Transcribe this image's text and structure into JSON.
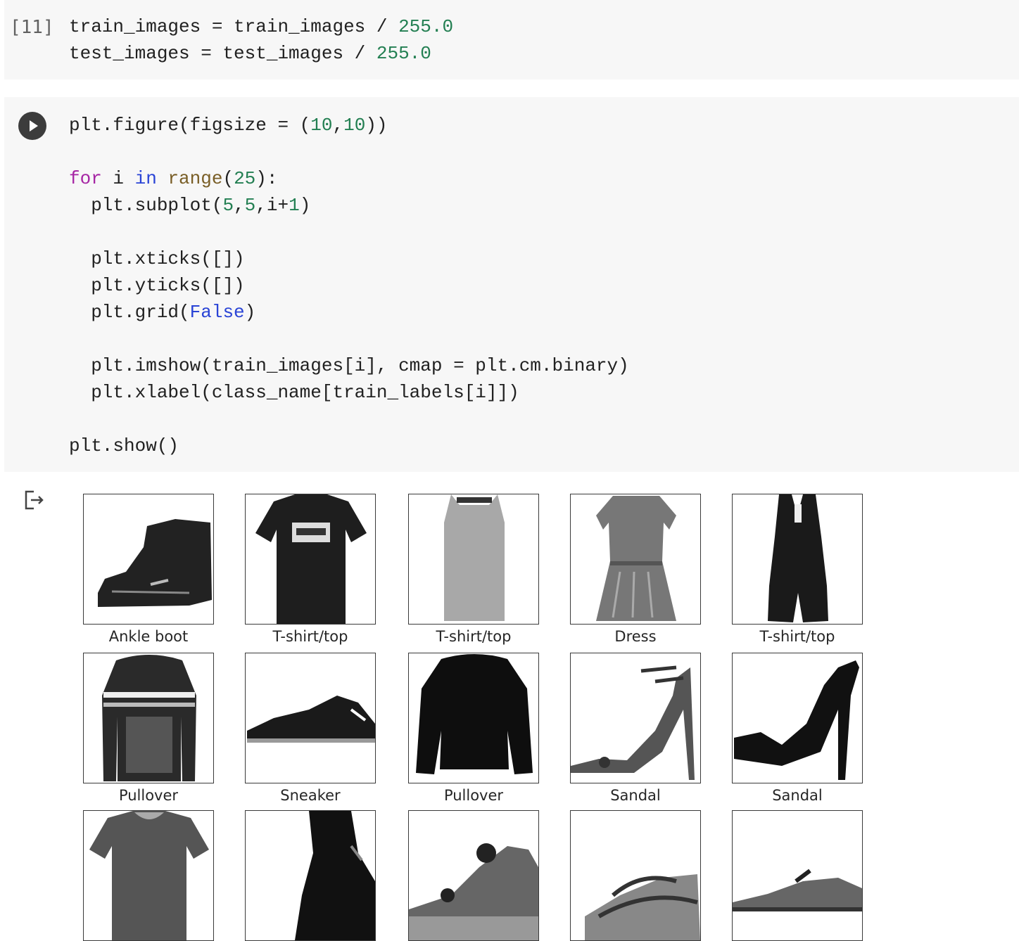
{
  "cell1": {
    "exec_count": "[11]",
    "lines": [
      [
        {
          "t": "train_images = train_images / ",
          "c": ""
        },
        {
          "t": "255.0",
          "c": "num"
        }
      ],
      [
        {
          "t": "test_images = test_images / ",
          "c": ""
        },
        {
          "t": "255.0",
          "c": "num"
        }
      ]
    ]
  },
  "cell2": {
    "lines": [
      [
        {
          "t": "plt.figure(figsize = (",
          "c": ""
        },
        {
          "t": "10",
          "c": "num"
        },
        {
          "t": ",",
          "c": ""
        },
        {
          "t": "10",
          "c": "num"
        },
        {
          "t": "))",
          "c": ""
        }
      ],
      [],
      [
        {
          "t": "for",
          "c": "kw"
        },
        {
          "t": " i ",
          "c": ""
        },
        {
          "t": "in",
          "c": "kw2"
        },
        {
          "t": " ",
          "c": ""
        },
        {
          "t": "range",
          "c": "bi"
        },
        {
          "t": "(",
          "c": ""
        },
        {
          "t": "25",
          "c": "num"
        },
        {
          "t": "):",
          "c": ""
        }
      ],
      [
        {
          "t": "  plt.subplot(",
          "c": ""
        },
        {
          "t": "5",
          "c": "num"
        },
        {
          "t": ",",
          "c": ""
        },
        {
          "t": "5",
          "c": "num"
        },
        {
          "t": ",i+",
          "c": ""
        },
        {
          "t": "1",
          "c": "num"
        },
        {
          "t": ")",
          "c": ""
        }
      ],
      [],
      [
        {
          "t": "  plt.xticks([])",
          "c": ""
        }
      ],
      [
        {
          "t": "  plt.yticks([])",
          "c": ""
        }
      ],
      [
        {
          "t": "  plt.grid(",
          "c": ""
        },
        {
          "t": "False",
          "c": "kw2"
        },
        {
          "t": ")",
          "c": ""
        }
      ],
      [],
      [
        {
          "t": "  plt.imshow(train_images[i], cmap = plt.cm.binary)",
          "c": ""
        }
      ],
      [
        {
          "t": "  plt.xlabel(class_name[train_labels[i]])",
          "c": ""
        }
      ],
      [],
      [
        {
          "t": "plt.show()",
          "c": ""
        }
      ]
    ]
  },
  "output": {
    "labels": [
      "Ankle boot",
      "T-shirt/top",
      "T-shirt/top",
      "Dress",
      "T-shirt/top",
      "Pullover",
      "Sneaker",
      "Pullover",
      "Sandal",
      "Sandal",
      "",
      "",
      "",
      "",
      ""
    ],
    "images": [
      "boot",
      "tshirt-logo",
      "tank-top",
      "dress",
      "romper",
      "striped-sweater",
      "sneaker",
      "pullover",
      "high-heel-sandal",
      "heeled-sandal",
      "tshirt-grey",
      "boot-dark",
      "sandal-flat",
      "sandal-strappy",
      "sneaker-low"
    ]
  }
}
